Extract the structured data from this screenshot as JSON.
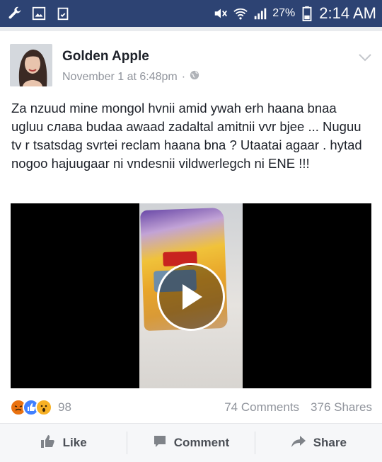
{
  "statusbar": {
    "battery": "27%",
    "time": "2:14 AM",
    "icons": [
      "wrench-icon",
      "image-icon",
      "clipboard-icon",
      "mute-icon",
      "wifi-icon",
      "signal-icon",
      "battery-icon"
    ]
  },
  "post": {
    "author": "Golden Apple",
    "timestamp": "November 1 at 6:48pm",
    "separator": "·",
    "privacy_icon": "globe-icon",
    "text": "Za nzuud mine mongol hvnii amid ywah erh haana bnaa ugluu слава budaa awaad zadaltal amitnii vvr bjee ... Nuguu tv r tsatsdag svrtei reclam haana bna ? Utaatai agaar . hytad nogoo hajuugaar ni vndesnii vildwerlegch ni ENE !!!",
    "reaction_count": "98",
    "comments": "74 Comments",
    "shares": "376 Shares"
  },
  "actions": {
    "like": "Like",
    "comment": "Comment",
    "share": "Share"
  },
  "colors": {
    "statusbar": "#2d4373",
    "angry": "#e9710f",
    "like": "#4080ff",
    "wow": "#f7b125"
  }
}
